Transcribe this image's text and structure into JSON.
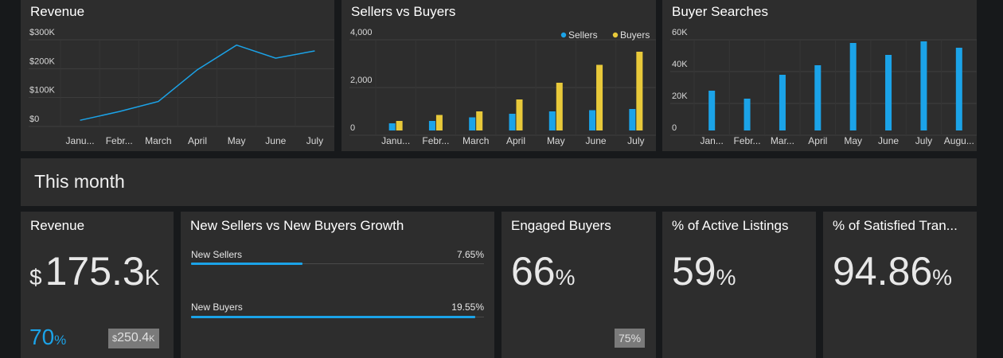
{
  "colors": {
    "accent": "#1ba3e8",
    "yellow": "#e8c93a",
    "panel": "#2d2d2d",
    "background": "#17191b"
  },
  "section": {
    "title": "This month"
  },
  "chart_data": [
    {
      "type": "line",
      "title": "Revenue",
      "categories": [
        "Janu...",
        "Febr...",
        "March",
        "April",
        "May",
        "June",
        "July"
      ],
      "series": [
        {
          "values": [
            5000,
            35000,
            70000,
            180000,
            265000,
            220000,
            245000
          ]
        }
      ],
      "y_ticks": [
        "$0",
        "$100K",
        "$200K",
        "$300K"
      ],
      "ylim": [
        0,
        300000
      ],
      "grid": true
    },
    {
      "type": "bar",
      "title": "Sellers vs Buyers",
      "categories": [
        "Janu...",
        "Febr...",
        "March",
        "April",
        "May",
        "June",
        "July"
      ],
      "series": [
        {
          "name": "Sellers",
          "color": "#1ba3e8",
          "values": [
            300,
            400,
            550,
            700,
            800,
            850,
            900
          ]
        },
        {
          "name": "Buyers",
          "color": "#e8c93a",
          "values": [
            400,
            650,
            800,
            1300,
            2000,
            2750,
            3300
          ]
        }
      ],
      "y_ticks": [
        "0",
        "2,000",
        "4,000"
      ],
      "ylim": [
        0,
        4000
      ],
      "legend": "top-right",
      "grid": true
    },
    {
      "type": "bar",
      "title": "Buyer Searches",
      "categories": [
        "Jan...",
        "Febr...",
        "Mar...",
        "April",
        "May",
        "June",
        "July",
        "Augu..."
      ],
      "series": [
        {
          "color": "#1ba3e8",
          "values": [
            25000,
            20000,
            35000,
            41000,
            55000,
            47500,
            56000,
            52000
          ]
        }
      ],
      "y_ticks": [
        "0",
        "20K",
        "40K",
        "60K"
      ],
      "ylim": [
        0,
        60000
      ],
      "grid": true
    }
  ],
  "kpis": {
    "revenue": {
      "title": "Revenue",
      "currency": "$",
      "value": "175.3",
      "unit": "K",
      "percent": "70",
      "percent_unit": "%",
      "target_currency": "$",
      "target": "250.4",
      "target_unit": "K",
      "progress": 0.7
    },
    "growth": {
      "title": "New Sellers vs New Buyers Growth",
      "rows": [
        {
          "label": "New Sellers",
          "value": "7.65%",
          "progress": 0.38
        },
        {
          "label": "New Buyers",
          "value": "19.55%",
          "progress": 0.97
        }
      ]
    },
    "engaged": {
      "title": "Engaged Buyers",
      "value": "66",
      "unit": "%",
      "badge": "75%"
    },
    "active": {
      "title": "% of Active Listings",
      "value": "59",
      "unit": "%"
    },
    "satisfied": {
      "title": "% of Satisfied Tran...",
      "value": "94.86",
      "unit": "%"
    }
  }
}
